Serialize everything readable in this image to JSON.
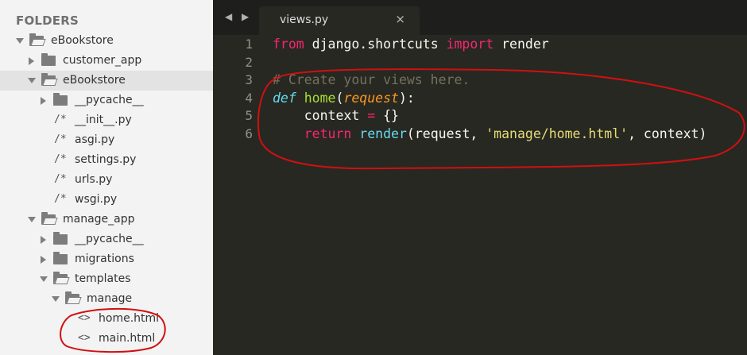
{
  "sidebar": {
    "title": "FOLDERS",
    "items": [
      {
        "label": "eBookstore",
        "kind": "folder",
        "state": "open",
        "depth": 0
      },
      {
        "label": "customer_app",
        "kind": "folder",
        "state": "closed",
        "depth": 1
      },
      {
        "label": "eBookstore",
        "kind": "folder",
        "state": "open",
        "depth": 1,
        "selected": true
      },
      {
        "label": "__pycache__",
        "kind": "folder",
        "state": "closed",
        "depth": 2
      },
      {
        "label": "__init__.py",
        "kind": "file",
        "glyph": "/*",
        "depth": 2
      },
      {
        "label": "asgi.py",
        "kind": "file",
        "glyph": "/*",
        "depth": 2
      },
      {
        "label": "settings.py",
        "kind": "file",
        "glyph": "/*",
        "depth": 2
      },
      {
        "label": "urls.py",
        "kind": "file",
        "glyph": "/*",
        "depth": 2
      },
      {
        "label": "wsgi.py",
        "kind": "file",
        "glyph": "/*",
        "depth": 2
      },
      {
        "label": "manage_app",
        "kind": "folder",
        "state": "open",
        "depth": 1
      },
      {
        "label": "__pycache__",
        "kind": "folder",
        "state": "closed",
        "depth": 2
      },
      {
        "label": "migrations",
        "kind": "folder",
        "state": "closed",
        "depth": 2
      },
      {
        "label": "templates",
        "kind": "folder",
        "state": "open",
        "depth": 2
      },
      {
        "label": "manage",
        "kind": "folder",
        "state": "open",
        "depth": 3
      },
      {
        "label": "home.html",
        "kind": "file",
        "glyph": "<>",
        "depth": 4
      },
      {
        "label": "main.html",
        "kind": "file",
        "glyph": "<>",
        "depth": 4
      }
    ]
  },
  "tabbar": {
    "nav_arrows": "◀ ▶",
    "tab_label": "views.py",
    "close_glyph": "×"
  },
  "editor": {
    "line_numbers": [
      "1",
      "2",
      "3",
      "4",
      "5",
      "6"
    ],
    "lines": [
      [
        {
          "t": "from",
          "c": "kw"
        },
        {
          "t": " django.shortcuts ",
          "c": ""
        },
        {
          "t": "import",
          "c": "kw"
        },
        {
          "t": " render",
          "c": ""
        }
      ],
      [],
      [
        {
          "t": "# Create your views here.",
          "c": "cm"
        }
      ],
      [
        {
          "t": "def",
          "c": "sto"
        },
        {
          "t": " ",
          "c": ""
        },
        {
          "t": "home",
          "c": "fn"
        },
        {
          "t": "(",
          "c": ""
        },
        {
          "t": "request",
          "c": "param"
        },
        {
          "t": "):",
          "c": ""
        }
      ],
      [
        {
          "t": "    context ",
          "c": ""
        },
        {
          "t": "=",
          "c": "kw"
        },
        {
          "t": " {}",
          "c": ""
        }
      ],
      [
        {
          "t": "    ",
          "c": ""
        },
        {
          "t": "return",
          "c": "kw"
        },
        {
          "t": " ",
          "c": ""
        },
        {
          "t": "render",
          "c": "sup"
        },
        {
          "t": "(request, ",
          "c": ""
        },
        {
          "t": "'manage/home.html'",
          "c": "str"
        },
        {
          "t": ", context)",
          "c": ""
        }
      ]
    ]
  },
  "colors": {
    "sidebar_bg": "#f3f3f3",
    "editor_bg": "#272822",
    "annotation": "#d01010"
  }
}
